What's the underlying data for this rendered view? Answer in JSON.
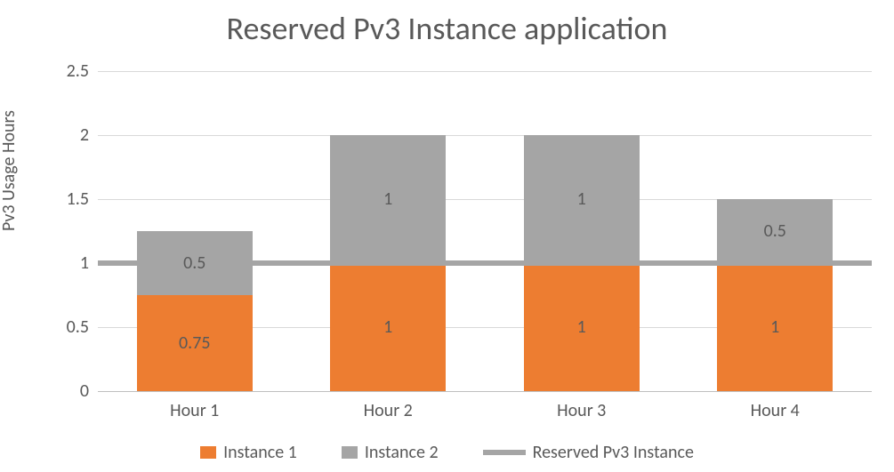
{
  "chart_data": {
    "type": "bar",
    "title": "Reserved Pv3 Instance application",
    "ylabel": "Pv3 Usage Hours",
    "xlabel": "",
    "categories": [
      "Hour 1",
      "Hour 2",
      "Hour 3",
      "Hour 4"
    ],
    "series": [
      {
        "name": "Instance 1",
        "values": [
          0.75,
          1,
          1,
          1
        ],
        "labels": [
          "0.75",
          "1",
          "1",
          "1"
        ],
        "color": "#ed7d31"
      },
      {
        "name": "Instance 2",
        "values": [
          0.5,
          1,
          1,
          0.5
        ],
        "labels": [
          "0.5",
          "1",
          "1",
          "0.5"
        ],
        "color": "#a5a5a5"
      }
    ],
    "reserved_line": {
      "name": "Reserved Pv3 Instance",
      "value": 1,
      "color": "#a5a5a5"
    },
    "ylim": [
      0,
      2.5
    ],
    "yticks": [
      0,
      0.5,
      1,
      1.5,
      2,
      2.5
    ],
    "ytick_labels": [
      "0",
      "0.5",
      "1",
      "1.5",
      "2",
      "2.5"
    ]
  },
  "legend": {
    "s1": "Instance 1",
    "s2": "Instance 2",
    "line": "Reserved Pv3 Instance"
  }
}
